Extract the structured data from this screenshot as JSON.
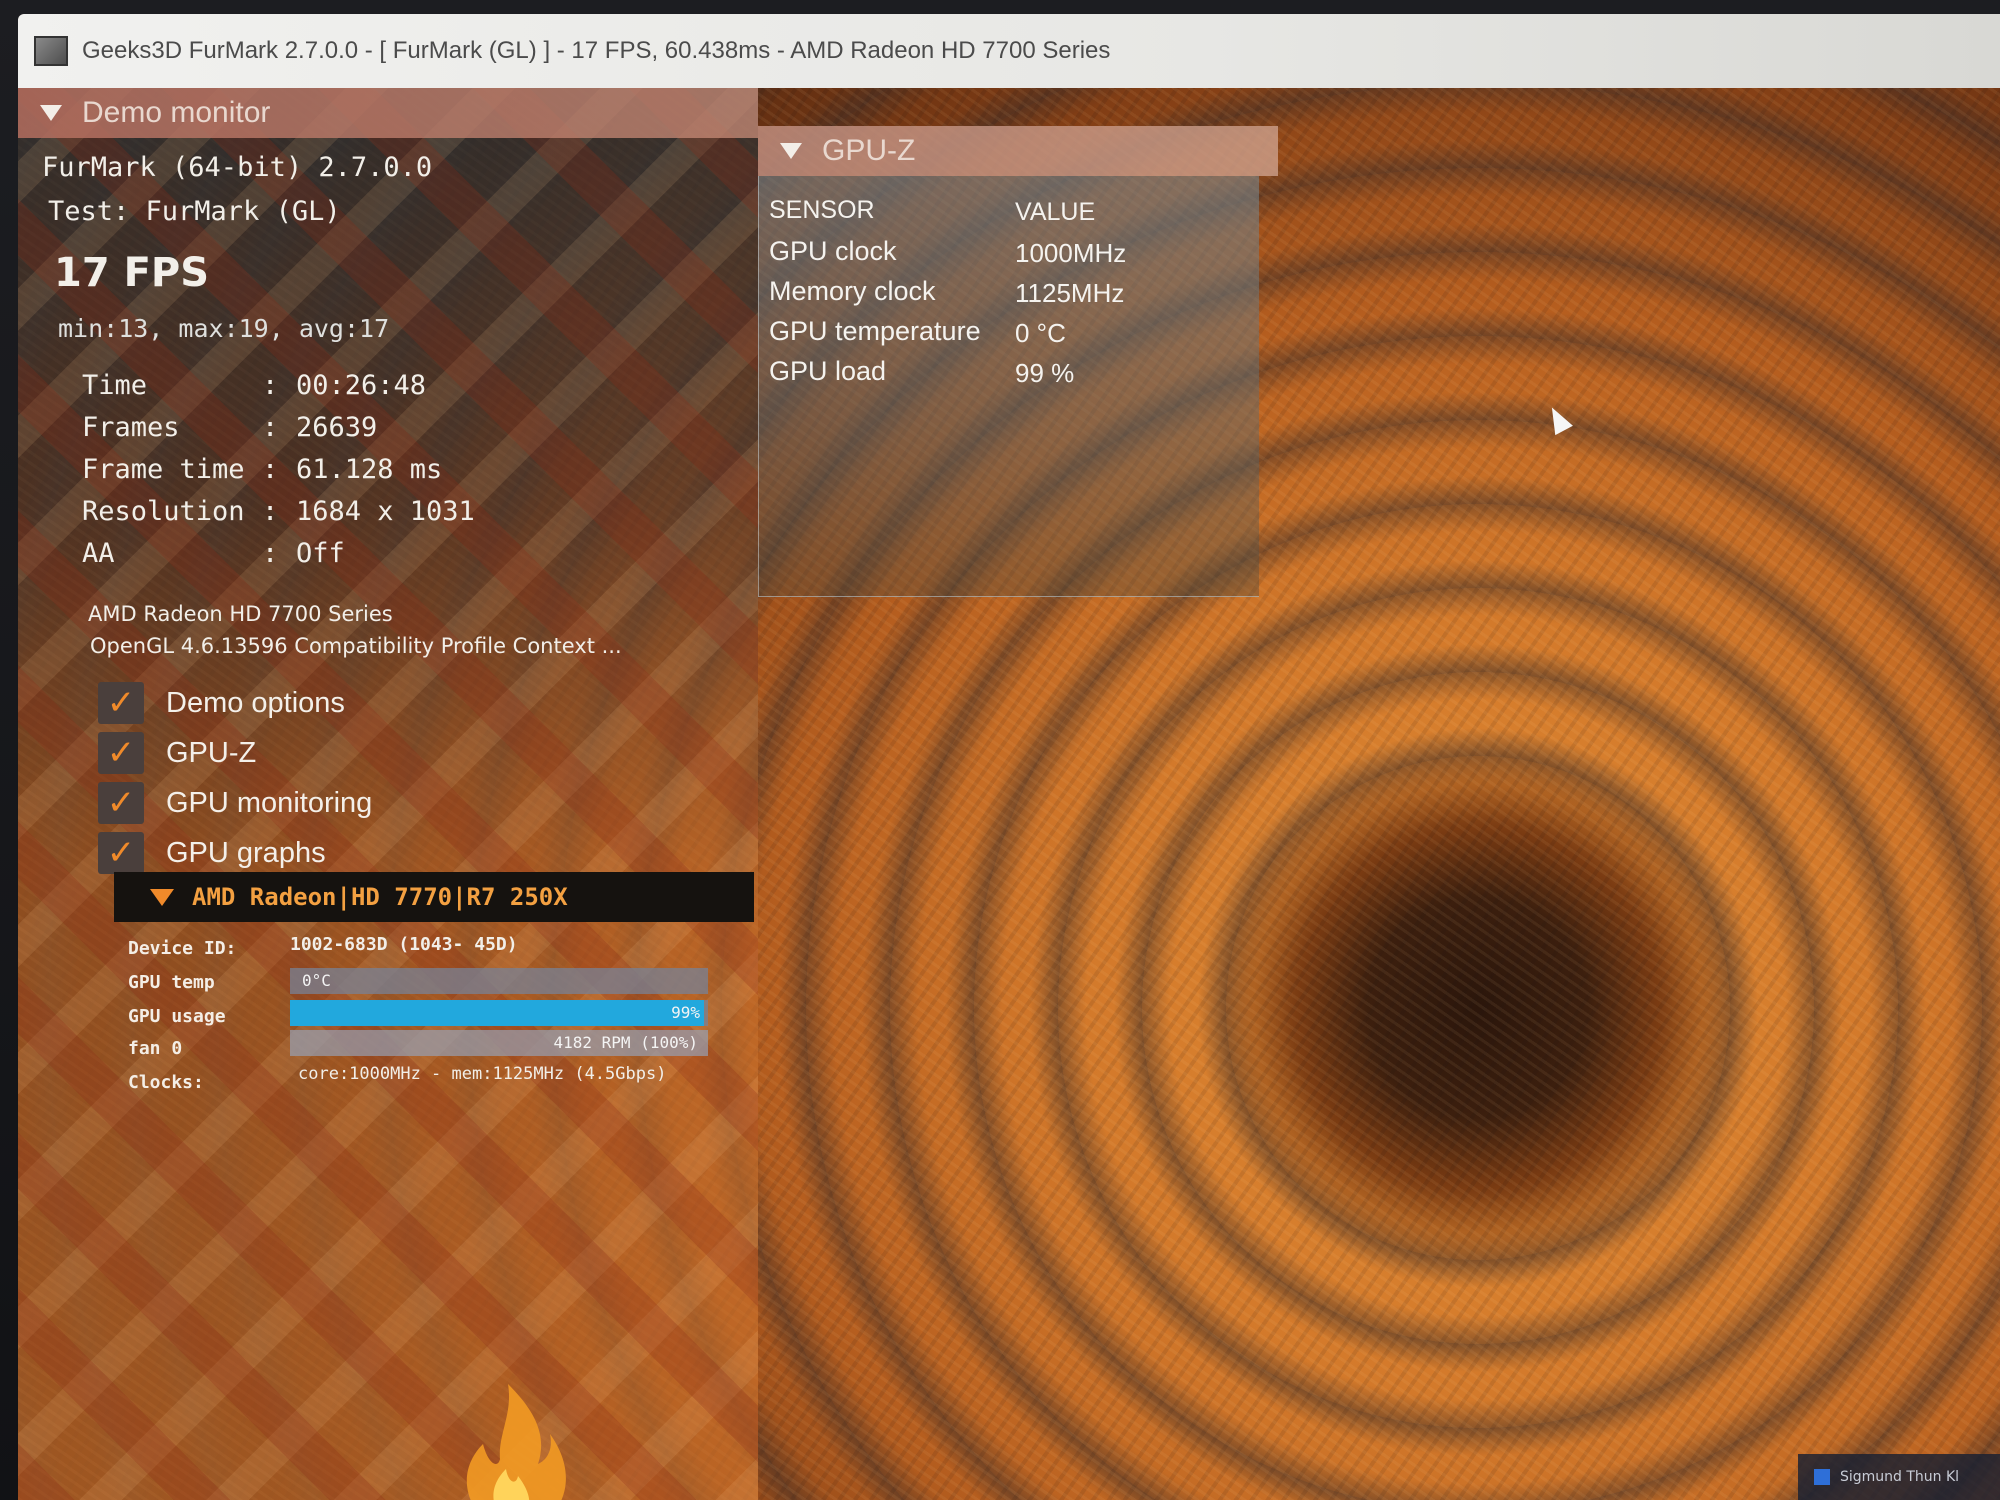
{
  "window": {
    "title": "Geeks3D FurMark 2.7.0.0 - [ FurMark (GL) ] - 17 FPS, 60.438ms - AMD Radeon HD 7700 Series"
  },
  "demo_monitor": {
    "header": "Demo monitor",
    "app_version": "FurMark (64-bit) 2.7.0.0",
    "test": "Test: FurMark (GL)",
    "fps": "17 FPS",
    "fps_stats": "min:13, max:19, avg:17",
    "stats": [
      {
        "key": "Time",
        "value": "00:26:48"
      },
      {
        "key": "Frames",
        "value": "26639"
      },
      {
        "key": "Frame time",
        "value": "61.128 ms"
      },
      {
        "key": "Resolution",
        "value": "1684 x 1031"
      },
      {
        "key": "AA",
        "value": "Off"
      }
    ],
    "gpu_name": "AMD Radeon HD 7700 Series",
    "opengl": "OpenGL 4.6.13596 Compatibility Profile Context ...",
    "options": [
      {
        "label": "Demo options",
        "checked": true
      },
      {
        "label": "GPU-Z",
        "checked": true
      },
      {
        "label": "GPU monitoring",
        "checked": true
      },
      {
        "label": "GPU graphs",
        "checked": true
      }
    ]
  },
  "gpu_monitor": {
    "header": "AMD Radeon|HD 7770|R7 250X",
    "device_id_label": "Device ID:",
    "device_id": "1002-683D (1043- 45D)",
    "gpu_temp_label": "GPU temp",
    "gpu_temp_value": "0°C",
    "gpu_temp_fraction": 0.0,
    "gpu_usage_label": "GPU usage",
    "gpu_usage_value": "99%",
    "gpu_usage_fraction": 0.99,
    "fan_label": "fan 0",
    "fan_value": "4182 RPM (100%)",
    "fan_fraction": 1.0,
    "clocks_label": "Clocks:",
    "clocks_value": "core:1000MHz - mem:1125MHz (4.5Gbps)"
  },
  "gpuz": {
    "header": "GPU-Z",
    "col_sensor": "SENSOR",
    "col_value": "VALUE",
    "rows": [
      {
        "sensor": "GPU clock",
        "value": "1000MHz"
      },
      {
        "sensor": "Memory clock",
        "value": "1125MHz"
      },
      {
        "sensor": "GPU temperature",
        "value": "0 °C"
      },
      {
        "sensor": "GPU load",
        "value": "99 %"
      }
    ]
  },
  "taskbar": {
    "app_label": "Sigmund Thun Kl"
  },
  "colors": {
    "accent_orange": "#f08a2a",
    "usage_bar": "#22a8dd"
  },
  "icons": [
    "app-icon",
    "collapse-triangle-icon",
    "checkmark-icon",
    "flame-icon",
    "mouse-cursor-icon"
  ]
}
